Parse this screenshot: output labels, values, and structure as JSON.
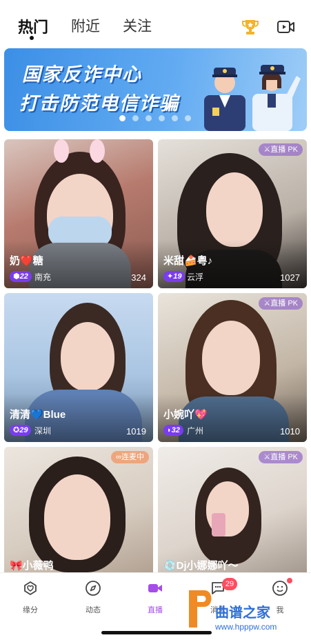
{
  "tabs": [
    {
      "label": "热门",
      "active": true
    },
    {
      "label": "附近",
      "active": false
    },
    {
      "label": "关注",
      "active": false
    }
  ],
  "header_icons": [
    "trophy-icon",
    "video-camera-icon"
  ],
  "banner": {
    "line1": "国家反诈中心",
    "line2": "打击防范电信诈骗",
    "slide_count": 6,
    "active_slide": 1
  },
  "cards": [
    {
      "name": "奶❤️糖",
      "level": "⬢22",
      "location": "南充",
      "viewers": "324",
      "badge": ""
    },
    {
      "name": "米甜🍰粤♪",
      "level": "✦19",
      "location": "云浮",
      "viewers": "1027",
      "badge": "⚔直播 PK"
    },
    {
      "name": "清清💙Blue",
      "level": "✪29",
      "location": "深圳",
      "viewers": "1019",
      "badge": ""
    },
    {
      "name": "小婉吖💖",
      "level": "◗32",
      "location": "广州",
      "viewers": "1010",
      "badge": "⚔直播 PK"
    },
    {
      "name": "🎀小薇鸭",
      "level": "",
      "location": "",
      "viewers": "",
      "badge": "∞连麦中"
    },
    {
      "name": "💿Dj小娜娜吖～",
      "level": "",
      "location": "",
      "viewers": "",
      "badge": "⚔直播 PK"
    }
  ],
  "bottom_nav": [
    {
      "label": "缘分",
      "icon": "heart-chat-icon",
      "active": false
    },
    {
      "label": "动态",
      "icon": "compass-icon",
      "active": false
    },
    {
      "label": "直播",
      "icon": "live-camera-icon",
      "active": true
    },
    {
      "label": "消息",
      "icon": "message-icon",
      "active": false
    },
    {
      "label": "我",
      "icon": "smile-icon",
      "active": false
    }
  ],
  "message_badge": "29",
  "watermark": {
    "text": "曲谱之家",
    "url": "www.hpppw.com"
  },
  "colors": {
    "accent": "#a64ce8",
    "badge_red": "#ff4d5e",
    "banner_blue": "#3c8fe6"
  }
}
